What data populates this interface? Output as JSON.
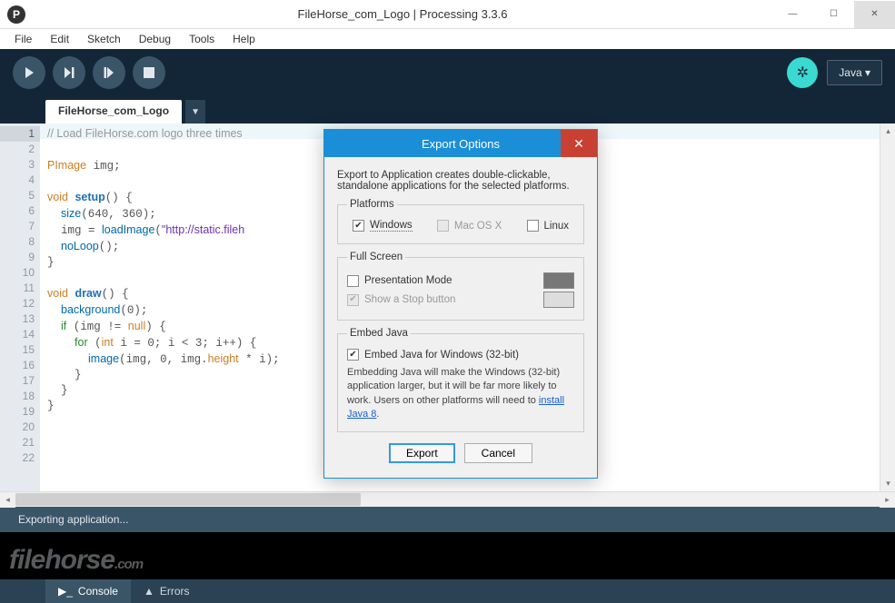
{
  "window": {
    "title": "FileHorse_com_Logo | Processing 3.3.6",
    "app_icon_letter": "P"
  },
  "menu": [
    "File",
    "Edit",
    "Sketch",
    "Debug",
    "Tools",
    "Help"
  ],
  "toolbar": {
    "mode_label": "Java ▾"
  },
  "tabs": {
    "active": "FileHorse_com_Logo"
  },
  "code_lines": [
    {
      "n": 1,
      "html": "<span class='kw-cm'>// Load FileHorse.com logo three times</span>"
    },
    {
      "n": 2,
      "html": ""
    },
    {
      "n": 3,
      "html": "<span class='kw-t'>PImage</span> img;"
    },
    {
      "n": 4,
      "html": ""
    },
    {
      "n": 5,
      "html": "<span class='kw-t'>void</span> <span class='kw-b'>setup</span>() {"
    },
    {
      "n": 6,
      "html": "  <span class='kw-fn'>size</span>(640, 360);"
    },
    {
      "n": 7,
      "html": "  img = <span class='kw-fn'>loadImage</span>(<span class='kw-str'>\"http://static.fileh</span>"
    },
    {
      "n": 8,
      "html": "  <span class='kw-fn'>noLoop</span>();"
    },
    {
      "n": 9,
      "html": "}"
    },
    {
      "n": 10,
      "html": ""
    },
    {
      "n": 11,
      "html": "<span class='kw-t'>void</span> <span class='kw-b'>draw</span>() {"
    },
    {
      "n": 12,
      "html": "  <span class='kw-fn'>background</span>(0);"
    },
    {
      "n": 13,
      "html": "  <span class='kw-k'>if</span> (img != <span class='kw-t'>null</span>) {"
    },
    {
      "n": 14,
      "html": "    <span class='kw-k'>for</span> (<span class='kw-t'>int</span> i = 0; i &lt; 3; i++) {"
    },
    {
      "n": 15,
      "html": "      <span class='kw-fn'>image</span>(img, 0, img.<span class='kw-t'>height</span> * i);"
    },
    {
      "n": 16,
      "html": "    }"
    },
    {
      "n": 17,
      "html": "  }"
    },
    {
      "n": 18,
      "html": "}"
    },
    {
      "n": 19,
      "html": ""
    },
    {
      "n": 20,
      "html": ""
    },
    {
      "n": 21,
      "html": ""
    },
    {
      "n": 22,
      "html": ""
    }
  ],
  "status": {
    "text": "Exporting application..."
  },
  "bottom_tabs": {
    "console": "Console",
    "errors": "Errors"
  },
  "watermark": {
    "name": "filehorse",
    "tld": ".com"
  },
  "dialog": {
    "title": "Export Options",
    "intro1": "Export to Application creates double-clickable,",
    "intro2": "standalone applications for the selected platforms.",
    "platforms": {
      "legend": "Platforms",
      "windows": "Windows",
      "mac": "Mac OS X",
      "linux": "Linux"
    },
    "fullscreen": {
      "legend": "Full Screen",
      "presentation": "Presentation Mode",
      "stop": "Show a Stop button"
    },
    "embed": {
      "legend": "Embed Java",
      "check": "Embed Java for Windows (32-bit)",
      "desc1": "Embedding Java will make the Windows (32-bit) application larger, but it will be far more likely to work. Users on other platforms will need to ",
      "link": "install Java 8",
      "desc2": "."
    },
    "buttons": {
      "export": "Export",
      "cancel": "Cancel"
    }
  }
}
